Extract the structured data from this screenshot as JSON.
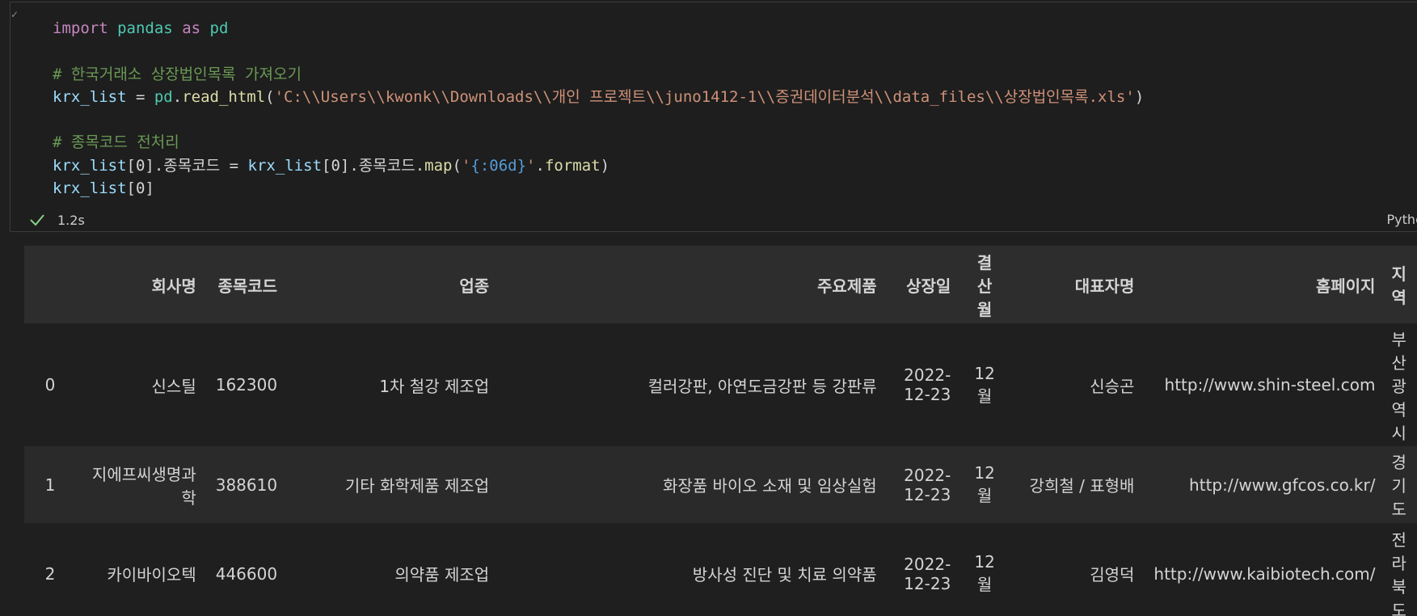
{
  "code_cell": {
    "lines": [
      [
        {
          "t": "import",
          "c": "kw"
        },
        {
          "t": " ",
          "c": ""
        },
        {
          "t": "pandas",
          "c": "mod"
        },
        {
          "t": " ",
          "c": ""
        },
        {
          "t": "as",
          "c": "kw"
        },
        {
          "t": " ",
          "c": ""
        },
        {
          "t": "pd",
          "c": "mod"
        }
      ],
      [],
      [
        {
          "t": "# 한국거래소 상장법인목록 가져오기",
          "c": "cmt"
        }
      ],
      [
        {
          "t": "krx_list",
          "c": "var"
        },
        {
          "t": " = ",
          "c": "punc"
        },
        {
          "t": "pd",
          "c": "mod"
        },
        {
          "t": ".",
          "c": "punc"
        },
        {
          "t": "read_html",
          "c": "fn"
        },
        {
          "t": "(",
          "c": "punc"
        },
        {
          "t": "'C:\\\\Users\\\\kwonk\\\\Downloads\\\\개인 프로젝트\\\\juno1412-1\\\\증권데이터분석\\\\data_files\\\\상장법인목록.xls'",
          "c": "str"
        },
        {
          "t": ")",
          "c": "punc"
        }
      ],
      [],
      [
        {
          "t": "# 종목코드 전처리",
          "c": "cmt"
        }
      ],
      [
        {
          "t": "krx_list",
          "c": "var"
        },
        {
          "t": "[0].종목코드 = ",
          "c": "punc"
        },
        {
          "t": "krx_list",
          "c": "var"
        },
        {
          "t": "[0].종목코드.",
          "c": "punc"
        },
        {
          "t": "map",
          "c": "fn"
        },
        {
          "t": "(",
          "c": "punc"
        },
        {
          "t": "'",
          "c": "str"
        },
        {
          "t": "{:06d}",
          "c": "fmt"
        },
        {
          "t": "'",
          "c": "str"
        },
        {
          "t": ".",
          "c": "punc"
        },
        {
          "t": "format",
          "c": "fn"
        },
        {
          "t": ")",
          "c": "punc"
        }
      ],
      [
        {
          "t": "krx_list",
          "c": "var"
        },
        {
          "t": "[0]",
          "c": "punc"
        }
      ]
    ],
    "status_time": "1.2s",
    "language": "Python",
    "colors": {
      "keyword": "#c586c0",
      "module": "#4ec9b0",
      "variable": "#9cdcfe",
      "function": "#dcdcaa",
      "string": "#ce9178",
      "format_placeholder": "#569cd6",
      "comment": "#6a9955",
      "success_check": "#89d185"
    }
  },
  "output_table": {
    "headers": {
      "index": "",
      "name": "회사명",
      "code": "종목코드",
      "industry": "업종",
      "product": "주요제품",
      "listed": "상장일",
      "month": "결산월",
      "rep": "대표자명",
      "home": "홈페이지",
      "region": "지역"
    },
    "rows": [
      {
        "index": "0",
        "name": "신스틸",
        "code": "162300",
        "industry": "1차 철강 제조업",
        "product": "컬러강판, 아연도금강판 등 강판류",
        "listed": "2022-12-23",
        "month": "12월",
        "rep": "신승곤",
        "home": "http://www.shin-steel.com",
        "region": "부산광역시"
      },
      {
        "index": "1",
        "name": "지에프씨생명과학",
        "code": "388610",
        "industry": "기타 화학제품 제조업",
        "product": "화장품 바이오 소재 및 임상실험",
        "listed": "2022-12-23",
        "month": "12월",
        "rep": "강희철 / 표형배",
        "home": "http://www.gfcos.co.kr/",
        "region": "경기도"
      },
      {
        "index": "2",
        "name": "카이바이오텍",
        "code": "446600",
        "industry": "의약품 제조업",
        "product": "방사성 진단 및 치료 의약품",
        "listed": "2022-12-23",
        "month": "12월",
        "rep": "김영덕",
        "home": "http://www.kaibiotech.com/",
        "region": "전라북도"
      }
    ]
  }
}
